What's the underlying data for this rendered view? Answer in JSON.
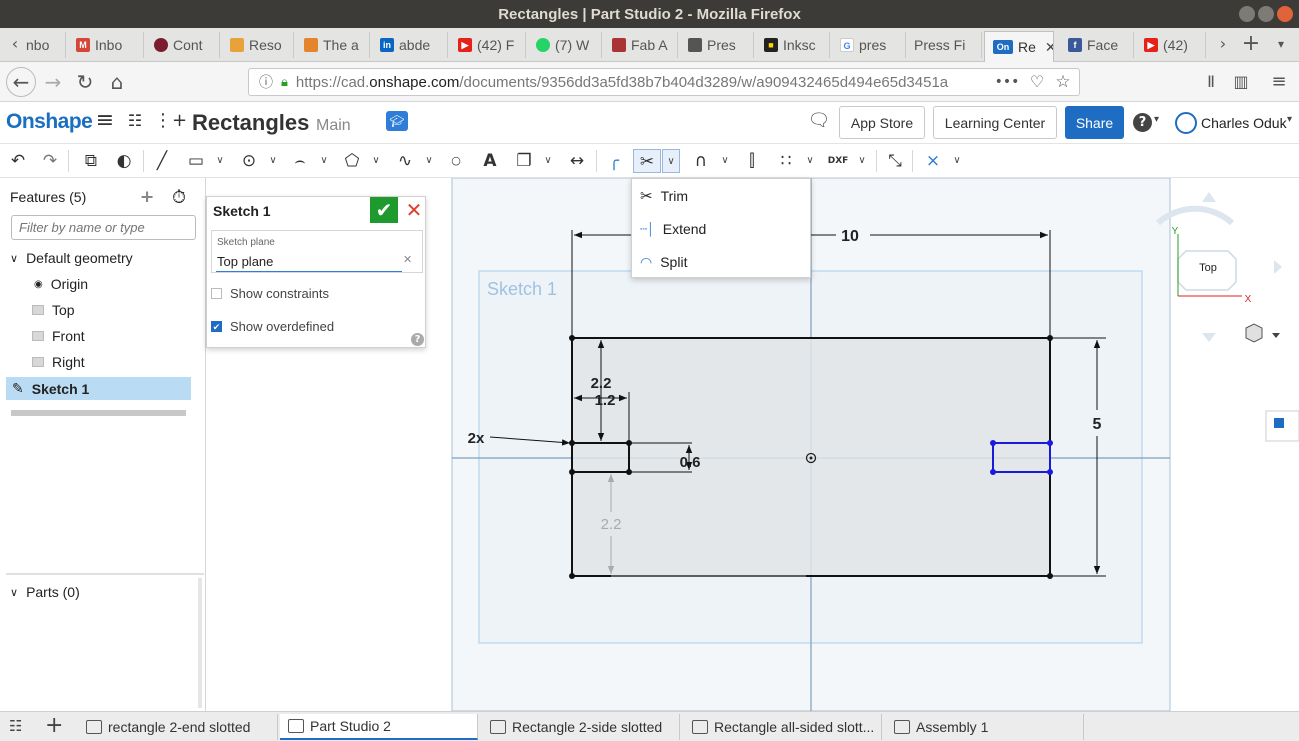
{
  "window": {
    "title": "Rectangles | Part Studio 2 - Mozilla Firefox"
  },
  "browser_tabs": [
    {
      "label": "nbo",
      "icon": "inbox-icon"
    },
    {
      "label": "Inbo",
      "icon": "gmail-icon"
    },
    {
      "label": "Cont",
      "icon": "contact-icon"
    },
    {
      "label": "Reso",
      "icon": "resource-icon"
    },
    {
      "label": "The a",
      "icon": "cube-icon"
    },
    {
      "label": "abde",
      "icon": "linkedin-icon"
    },
    {
      "label": "(42) F",
      "icon": "youtube-icon"
    },
    {
      "label": "(7) W",
      "icon": "whatsapp-icon"
    },
    {
      "label": "Fab A",
      "icon": "fab-icon"
    },
    {
      "label": "Pres",
      "icon": "press-icon"
    },
    {
      "label": "Inksc",
      "icon": "inkscape-icon"
    },
    {
      "label": "pres",
      "icon": "google-icon"
    },
    {
      "label": "Press Fi",
      "icon": ""
    },
    {
      "label": "Re",
      "icon": "onshape-icon",
      "active": true
    },
    {
      "label": "Face",
      "icon": "facebook-icon"
    },
    {
      "label": "(42)",
      "icon": "youtube-icon"
    }
  ],
  "navbar": {
    "url_prefix": "https://cad.",
    "url_domain": "onshape.com",
    "url_path": "/documents/9356dd3a5fd38b7b404d3289/w/a909432465d494e65d3451a",
    "more": "•••"
  },
  "header": {
    "logo": "Onshape",
    "doc_name": "Rectangles",
    "branch": "Main",
    "app_store": "App Store",
    "learning_center": "Learning Center",
    "share": "Share",
    "user": "Charles Oduk"
  },
  "features": {
    "title": "Features (5)",
    "filter_placeholder": "Filter by name or type",
    "default_geometry": "Default geometry",
    "items": [
      "Origin",
      "Top",
      "Front",
      "Right"
    ],
    "sketch": "Sketch 1",
    "parts": "Parts (0)"
  },
  "sketch_dialog": {
    "title": "Sketch 1",
    "plane_label": "Sketch plane",
    "plane_value": "Top plane",
    "show_constraints": "Show constraints",
    "show_overdefined": "Show overdefined"
  },
  "trim_menu": {
    "items": [
      "Trim",
      "Extend",
      "Split"
    ]
  },
  "canvas": {
    "sketch_label": "Sketch 1",
    "dims": {
      "width": "10",
      "height": "5",
      "slot_offset": "2.2",
      "slot_width": "1.2",
      "slot_height": "0.6",
      "lower_offset": "2.2",
      "count": "2x"
    }
  },
  "view_cube": {
    "face": "Top",
    "x_axis": "X",
    "y_axis": "Y"
  },
  "bottom_tabs": [
    {
      "label": "rectangle 2-end slotted"
    },
    {
      "label": "Part Studio 2",
      "active": true
    },
    {
      "label": "Rectangle 2-side slotted"
    },
    {
      "label": "Rectangle all-sided slott..."
    },
    {
      "label": "Assembly 1"
    }
  ]
}
